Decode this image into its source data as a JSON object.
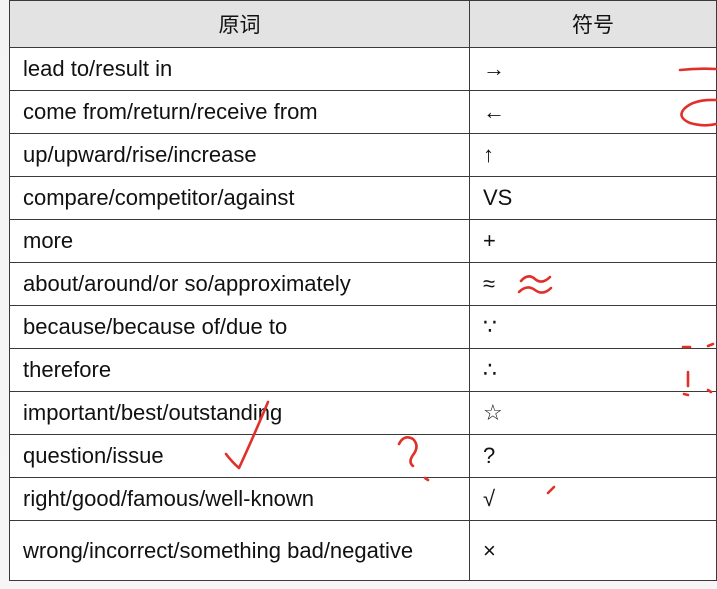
{
  "table": {
    "headers": [
      "原词",
      "符号"
    ],
    "rows": [
      {
        "word": "lead to/result in",
        "symbol": "→"
      },
      {
        "word": "come from/return/receive from",
        "symbol": "←"
      },
      {
        "word": "up/upward/rise/increase",
        "symbol": "↑"
      },
      {
        "word": "compare/competitor/against",
        "symbol": "VS"
      },
      {
        "word": "more",
        "symbol": "+"
      },
      {
        "word": "about/around/or so/approximately",
        "symbol": "≈"
      },
      {
        "word": "because/because of/due to",
        "symbol": "∵"
      },
      {
        "word": "therefore",
        "symbol": "∴"
      },
      {
        "word": "important/best/outstanding",
        "symbol": "☆"
      },
      {
        "word": "question/issue",
        "symbol": "?"
      },
      {
        "word": "right/good/famous/well-known",
        "symbol": "√"
      },
      {
        "word": "wrong/incorrect/something bad/negative",
        "symbol": "×"
      }
    ]
  },
  "annotation_color": "#e0302a"
}
